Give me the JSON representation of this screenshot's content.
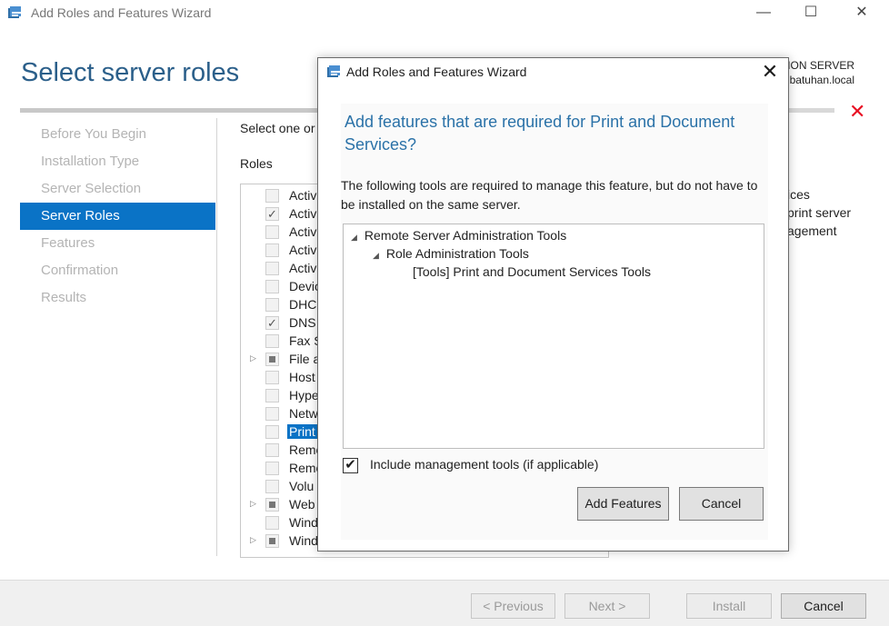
{
  "window": {
    "title": "Add Roles and Features Wizard",
    "controls": {
      "minimize": "—",
      "maximize": "☐",
      "close": "✕"
    }
  },
  "page": {
    "title": "Select server roles",
    "destination_line1": "TION SERVER",
    "destination_line2": "batuhan.local",
    "error_icon": "✕"
  },
  "nav": {
    "items": [
      {
        "label": "Before You Begin",
        "active": false
      },
      {
        "label": "Installation Type",
        "active": false
      },
      {
        "label": "Server Selection",
        "active": false
      },
      {
        "label": "Server Roles",
        "active": true
      },
      {
        "label": "Features",
        "active": false
      },
      {
        "label": "Confirmation",
        "active": false
      },
      {
        "label": "Results",
        "active": false
      }
    ]
  },
  "content": {
    "instruction": "Select one or",
    "roles_heading": "Roles",
    "description_fragments": [
      "ices",
      "print server",
      "agement"
    ],
    "roles": [
      {
        "label": "Activ",
        "state": "unchecked",
        "expander": false,
        "selected": false
      },
      {
        "label": "Activ",
        "state": "checked",
        "expander": false,
        "selected": false
      },
      {
        "label": "Activ",
        "state": "unchecked",
        "expander": false,
        "selected": false
      },
      {
        "label": "Activ",
        "state": "unchecked",
        "expander": false,
        "selected": false
      },
      {
        "label": "Activ",
        "state": "unchecked",
        "expander": false,
        "selected": false
      },
      {
        "label": "Devic",
        "state": "unchecked",
        "expander": false,
        "selected": false
      },
      {
        "label": "DHC",
        "state": "unchecked",
        "expander": false,
        "selected": false
      },
      {
        "label": "DNS",
        "state": "checked",
        "expander": false,
        "selected": false
      },
      {
        "label": "Fax S",
        "state": "unchecked",
        "expander": false,
        "selected": false
      },
      {
        "label": "File a",
        "state": "partial",
        "expander": true,
        "selected": false
      },
      {
        "label": "Host",
        "state": "unchecked",
        "expander": false,
        "selected": false
      },
      {
        "label": "Hype",
        "state": "unchecked",
        "expander": false,
        "selected": false
      },
      {
        "label": "Netw",
        "state": "unchecked",
        "expander": false,
        "selected": false
      },
      {
        "label": "Print",
        "state": "unchecked",
        "expander": false,
        "selected": true
      },
      {
        "label": "Remo",
        "state": "unchecked",
        "expander": false,
        "selected": false
      },
      {
        "label": "Remo",
        "state": "unchecked",
        "expander": false,
        "selected": false
      },
      {
        "label": "Volu",
        "state": "unchecked",
        "expander": false,
        "selected": false
      },
      {
        "label": "Web",
        "state": "partial",
        "expander": true,
        "selected": false
      },
      {
        "label": "Wind",
        "state": "unchecked",
        "expander": false,
        "selected": false
      },
      {
        "label": "Wind",
        "state": "partial",
        "expander": true,
        "selected": false
      }
    ]
  },
  "footer": {
    "previous": "< Previous",
    "next": "Next >",
    "install": "Install",
    "cancel": "Cancel"
  },
  "dialog": {
    "title": "Add Roles and Features Wizard",
    "close": "✕",
    "heading": "Add features that are required for Print and Document Services?",
    "description": "The following tools are required to manage this feature, but do not have to be installed on the same server.",
    "tree": [
      {
        "label": "Remote Server Administration Tools",
        "level": 0,
        "arrow": true
      },
      {
        "label": "Role Administration Tools",
        "level": 1,
        "arrow": true
      },
      {
        "label": "[Tools] Print and Document Services Tools",
        "level": 2,
        "arrow": false
      }
    ],
    "include_tools_label": "Include management tools (if applicable)",
    "include_tools_checked": true,
    "add_button": "Add Features",
    "cancel_button": "Cancel"
  }
}
